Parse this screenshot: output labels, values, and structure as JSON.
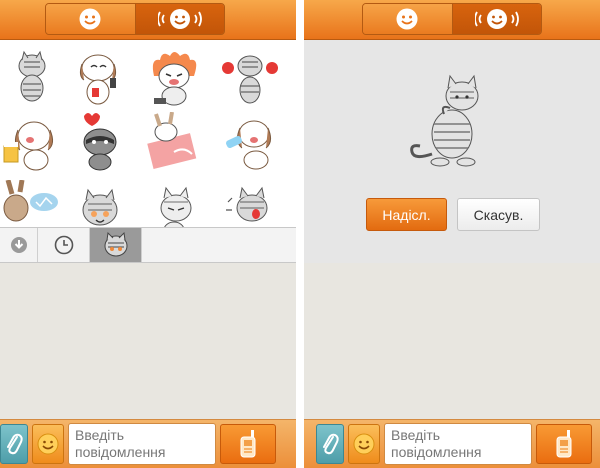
{
  "left_screen": {
    "top_tabs": [
      {
        "icon": "smiley-face-icon",
        "active": false
      },
      {
        "icon": "voice-smiley-icon",
        "active": true
      }
    ],
    "sticker_grid": [
      {
        "icon": "striped-cat-sticker-icon"
      },
      {
        "icon": "shih-tzu-phone-sticker-icon"
      },
      {
        "icon": "angry-cat-fire-sticker-icon"
      },
      {
        "icon": "boxing-cat-sticker-icon"
      },
      {
        "icon": "shih-tzu-beer-sticker-icon"
      },
      {
        "icon": "raccoon-heartbroken-sticker-icon"
      },
      {
        "icon": "rabbit-lying-sticker-icon"
      },
      {
        "icon": "shih-tzu-drinking-sticker-icon"
      },
      {
        "icon": "rabbit-speech-sticker-icon"
      },
      {
        "icon": "cat-smiling-sticker-icon"
      },
      {
        "icon": "cat-smug-sticker-icon"
      },
      {
        "icon": "cat-scared-sticker-icon"
      }
    ],
    "category_tabs": [
      {
        "icon": "download-icon"
      },
      {
        "icon": "recent-clock-icon"
      },
      {
        "icon": "cat-pack-icon",
        "selected": true
      }
    ]
  },
  "right_screen": {
    "preview_sticker": "cat-thinking-sticker-icon",
    "send_button": "Надісл.",
    "cancel_button": "Скасув."
  },
  "composer": {
    "placeholder": "Введіть повідомлення",
    "attach_icon": "paperclip-icon",
    "emoji_icon": "smiley-face-icon",
    "voice_icon": "walkie-talkie-icon"
  },
  "colors": {
    "accent_orange": "#ee8a2a",
    "attach_teal": "#5aa9b3",
    "background_beige": "#e8e6e0"
  }
}
